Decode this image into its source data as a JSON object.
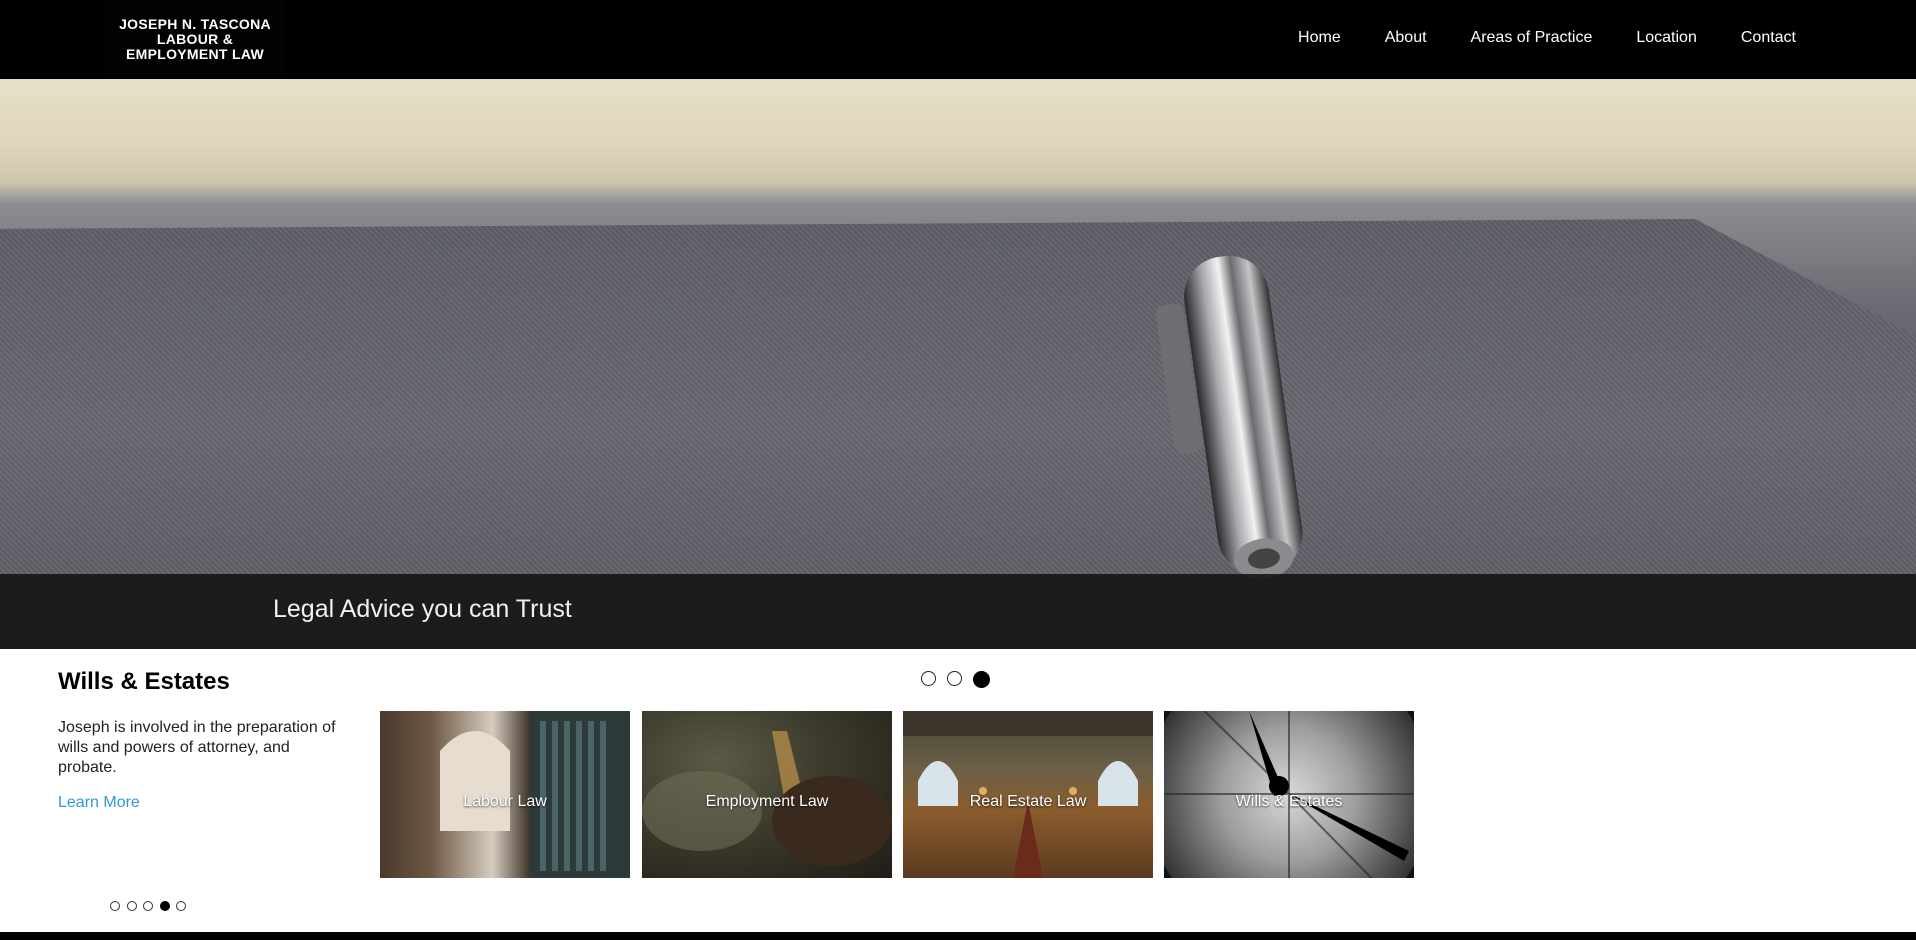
{
  "header": {
    "logo_text": "JOSEPH N. TASCONA\nLABOUR &\nEMPLOYMENT LAW",
    "nav": [
      "Home",
      "About",
      "Areas of Practice",
      "Location",
      "Contact"
    ]
  },
  "hero": {
    "caption": "Legal Advice you can Trust",
    "active_slide": 3,
    "slide_count": 3
  },
  "feature": {
    "title": "Wills & Estates",
    "description": "Joseph is involved in the preparation of wills and powers of attorney, and probate.",
    "link": "Learn More",
    "active_dot": 4,
    "dot_count": 5
  },
  "tiles": [
    {
      "label": "Labour Law"
    },
    {
      "label": "Employment Law"
    },
    {
      "label": "Real Estate Law"
    },
    {
      "label": "Wills & Estates"
    }
  ],
  "colors": {
    "header_bg": "#000000",
    "link": "#2d9bd6"
  }
}
